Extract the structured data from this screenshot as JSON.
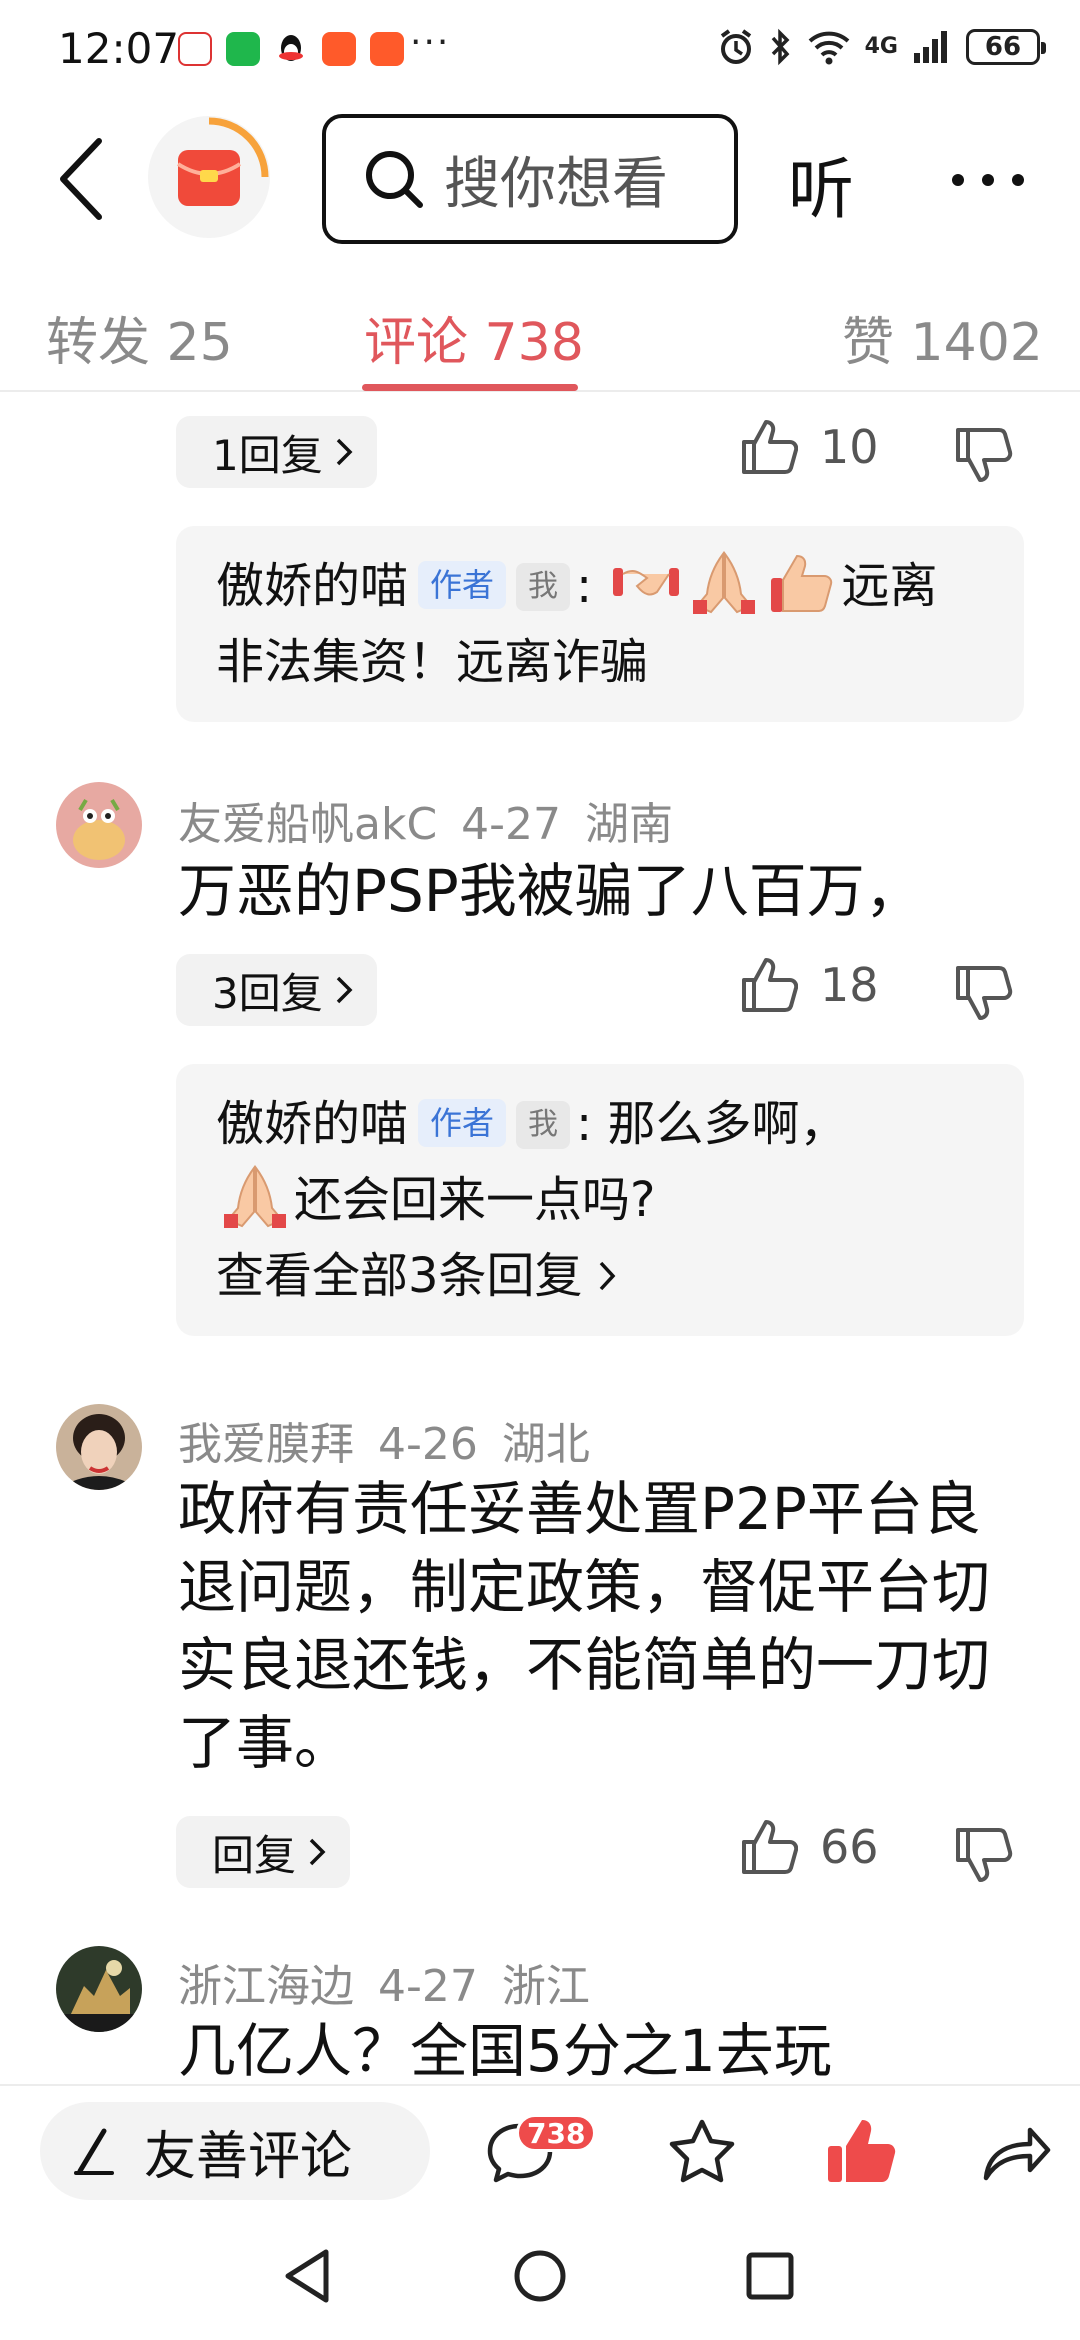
{
  "status_bar": {
    "time": "12:07",
    "more_dots": "···",
    "network": "4G",
    "battery": "66"
  },
  "header": {
    "search_placeholder": "搜你想看",
    "listen_label": "听"
  },
  "tabs": [
    {
      "label": "转发 25"
    },
    {
      "label": "评论 738"
    },
    {
      "label": "赞 1402"
    }
  ],
  "comments": {
    "c1": {
      "replies_label": "1回复",
      "likes": "10",
      "reply": {
        "author": "傲娇的喵",
        "author_tag": "作者",
        "me_tag": "我",
        "text": "远离非法集资！远离诈骗"
      }
    },
    "c2": {
      "user": "友爱船帆akC",
      "date": "4-27",
      "location": "湖南",
      "text": "万恶的PSP我被骗了八百万，",
      "replies_label": "3回复",
      "likes": "18",
      "reply": {
        "author": "傲娇的喵",
        "author_tag": "作者",
        "me_tag": "我",
        "text_line1": "那么多啊，",
        "text_line2": "还会回来一点吗?",
        "view_all": "查看全部3条回复"
      }
    },
    "c3": {
      "user": "我爱膜拜",
      "date": "4-26",
      "location": "湖北",
      "text": "政府有责任妥善处置P2P平台良退问题，制定政策，督促平台切实良退还钱，不能简单的一刀切了事。",
      "replies_label": "回复",
      "likes": "66"
    },
    "c4": {
      "user": "浙江海边",
      "date": "4-27",
      "location": "浙江",
      "text": "几亿人？全国5分之1去玩"
    }
  },
  "bottom_bar": {
    "comment_placeholder": "友善评论",
    "comment_count": "738"
  },
  "colors": {
    "accent": "#e0575c",
    "like_active": "#ee4b4b",
    "author_tag": "#3b74d6"
  }
}
